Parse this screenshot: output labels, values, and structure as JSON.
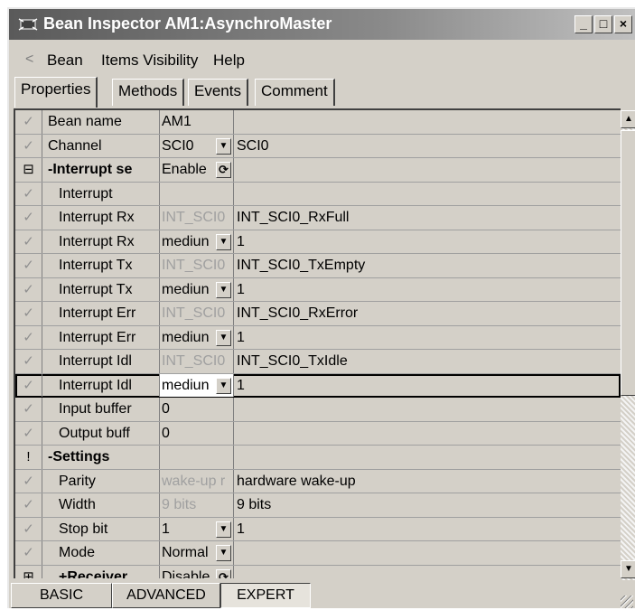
{
  "window": {
    "title": "Bean Inspector AM1:AsynchroMaster",
    "minimize": "_",
    "maximize": "□",
    "close": "×"
  },
  "menu": {
    "back": "<",
    "items": [
      "Bean",
      "Items Visibility",
      "Help"
    ]
  },
  "tabs": [
    "Properties",
    "Methods",
    "Events",
    "Comment"
  ],
  "active_tab": "Properties",
  "rows": [
    {
      "icon": "✓",
      "name": "Bean name",
      "value": "AM1",
      "desc": "",
      "indent": 0
    },
    {
      "icon": "✓",
      "name": "Channel",
      "value": "SCI0",
      "desc": "SCI0",
      "indent": 0
    },
    {
      "icon": "⊟",
      "name": "-Interrupt se",
      "value": "Enable",
      "desc": "",
      "indent": 0
    },
    {
      "icon": "✓",
      "name": "Interrupt",
      "value": "",
      "desc": "",
      "indent": 1
    },
    {
      "icon": "✓",
      "name": "Interrupt Rx",
      "value": "INT_SCI0",
      "desc": "INT_SCI0_RxFull",
      "indent": 1
    },
    {
      "icon": "✓",
      "name": "Interrupt Rx",
      "value": "mediun",
      "desc": "1",
      "indent": 1
    },
    {
      "icon": "✓",
      "name": "Interrupt Tx",
      "value": "INT_SCI0",
      "desc": "INT_SCI0_TxEmpty",
      "indent": 1
    },
    {
      "icon": "✓",
      "name": "Interrupt Tx",
      "value": "mediun",
      "desc": "1",
      "indent": 1
    },
    {
      "icon": "✓",
      "name": "Interrupt Err",
      "value": "INT_SCI0",
      "desc": "INT_SCI0_RxError",
      "indent": 1
    },
    {
      "icon": "✓",
      "name": "Interrupt Err",
      "value": "mediun",
      "desc": "1",
      "indent": 1
    },
    {
      "icon": "✓",
      "name": "Interrupt Idl",
      "value": "INT_SCI0",
      "desc": "INT_SCI0_TxIdle",
      "indent": 1
    },
    {
      "icon": "✓",
      "name": "Interrupt Idl",
      "value": "mediun",
      "desc": "1",
      "indent": 1
    },
    {
      "icon": "✓",
      "name": "Input buffer",
      "value": "0",
      "desc": "",
      "indent": 1
    },
    {
      "icon": "✓",
      "name": "Output buff",
      "value": "0",
      "desc": "",
      "indent": 1
    },
    {
      "icon": "!",
      "name": "-Settings",
      "value": "",
      "desc": "",
      "indent": 0
    },
    {
      "icon": "✓",
      "name": "Parity",
      "value": "wake-up r",
      "desc": "hardware wake-up",
      "indent": 1
    },
    {
      "icon": "✓",
      "name": "Width",
      "value": "9 bits",
      "desc": "9 bits",
      "indent": 1
    },
    {
      "icon": "✓",
      "name": "Stop bit",
      "value": "1",
      "desc": "1",
      "indent": 1
    },
    {
      "icon": "✓",
      "name": "Mode",
      "value": "Normal",
      "desc": "",
      "indent": 1
    },
    {
      "icon": "⊞",
      "name": "+Receiver",
      "value": "Disable",
      "desc": "",
      "indent": 1
    }
  ],
  "bottom_buttons": [
    "BASIC",
    "ADVANCED",
    "EXPERT"
  ],
  "active_level": "EXPERT",
  "scroll": {
    "up": "▲",
    "down": "▼"
  }
}
